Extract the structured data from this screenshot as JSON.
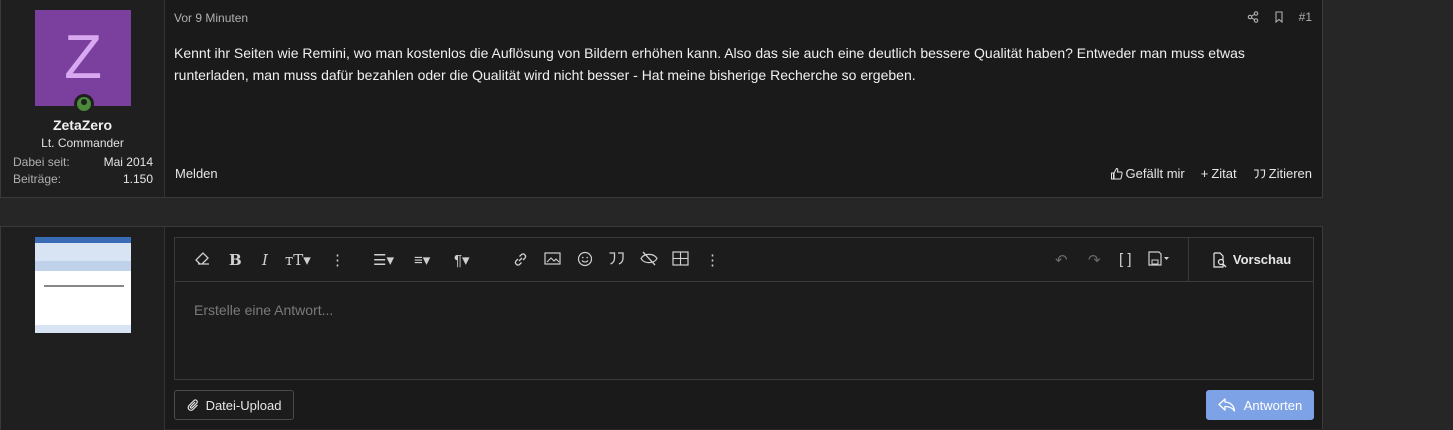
{
  "post": {
    "avatar_letter": "Z",
    "username": "ZetaZero",
    "user_title": "Lt. Commander",
    "stats": [
      {
        "key": "Dabei seit:",
        "value": "Mai 2014"
      },
      {
        "key": "Beiträge:",
        "value": "1.150"
      }
    ],
    "time": "Vor 9 Minuten",
    "post_number": "#1",
    "body": "Kennt ihr Seiten wie Remini, wo man kostenlos die Auflösung von Bildern erhöhen kann. Also das sie auch eine deutlich bessere Qualität haben? Entweder man muss etwas runterladen, man muss dafür bezahlen oder die Qualität wird nicht besser - Hat meine bisherige Recherche so ergeben.",
    "report_label": "Melden",
    "actions": {
      "like": "Gefällt mir",
      "quote_plus": "Zitat",
      "quote": "Zitieren"
    }
  },
  "reply": {
    "placeholder": "Erstelle eine Antwort...",
    "preview_label": "Vorschau",
    "upload_label": "Datei-Upload",
    "submit_label": "Antworten"
  },
  "colors": {
    "avatar_bg": "#7b3f9e",
    "submit_bg": "#7ea2e6",
    "online": "#4b8a3a"
  }
}
